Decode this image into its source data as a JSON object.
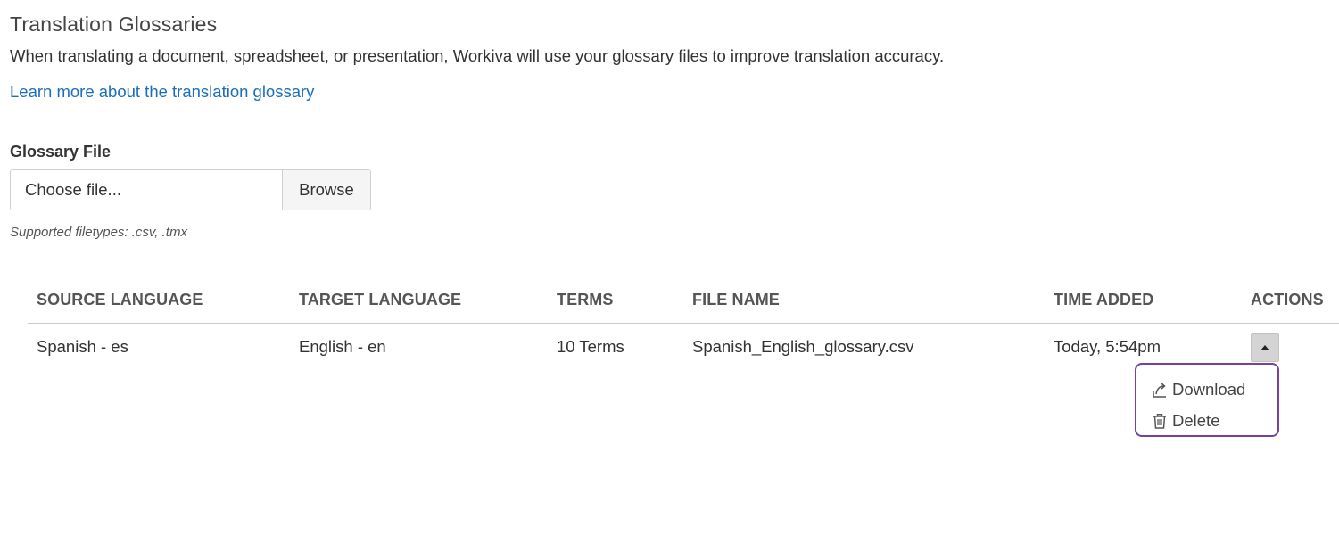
{
  "header": {
    "title": "Translation Glossaries",
    "description": "When translating a document, spreadsheet, or presentation, Workiva will use your glossary files to improve translation accuracy.",
    "learn_more_link": "Learn more about the translation glossary"
  },
  "upload": {
    "label": "Glossary File",
    "placeholder": "Choose file...",
    "browse_label": "Browse",
    "hint": "Supported filetypes: .csv, .tmx"
  },
  "table": {
    "columns": {
      "source": "SOURCE LANGUAGE",
      "target": "TARGET LANGUAGE",
      "terms": "TERMS",
      "file_name": "FILE NAME",
      "time_added": "TIME ADDED",
      "actions": "ACTIONS"
    },
    "rows": [
      {
        "source": "Spanish - es",
        "target": "English - en",
        "terms": "10 Terms",
        "file_name": "Spanish_English_glossary.csv",
        "time_added": "Today, 5:54pm"
      }
    ]
  },
  "actions_menu": {
    "download_label": "Download",
    "delete_label": "Delete",
    "download_icon": "download-icon",
    "delete_icon": "trash-icon",
    "border_color": "#7b3fa0"
  },
  "colors": {
    "link": "#1a6ebd",
    "text": "#333333",
    "header_text": "#555555"
  }
}
